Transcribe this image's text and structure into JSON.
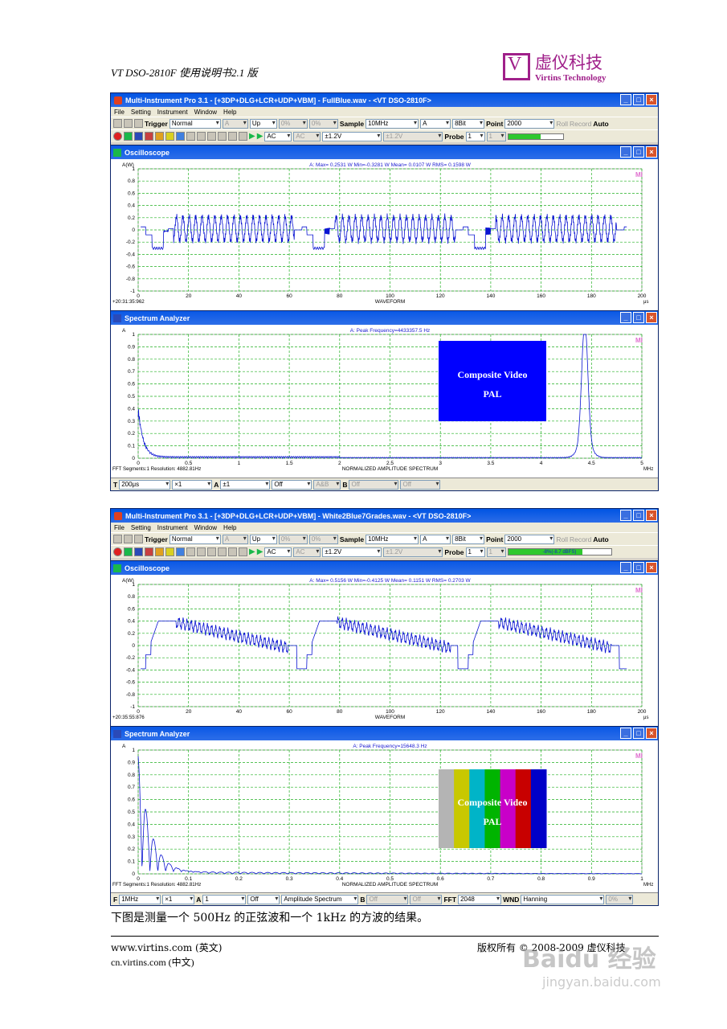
{
  "doc": {
    "header_title": "VT DSO-2810F 使用说明书2.1 版",
    "logo_cn": "虚仪科技",
    "logo_en": "Virtins Technology",
    "caption": "下图是测量一个 500Hz 的正弦波和一个 1kHz 的方波的结果。",
    "footer_left_1": "www.virtins.com (英文)",
    "footer_left_2": "cn.virtins.com (中文)",
    "footer_right": "版权所有 © 2008-2009 虚仪科技",
    "watermark": "Baidu 经验",
    "watermark_url": "jingyan.baidu.com"
  },
  "menu": [
    "File",
    "Setting",
    "Instrument",
    "Window",
    "Help"
  ],
  "toolbar": {
    "trigger_label": "Trigger",
    "trigger_mode": "Normal",
    "trigger_ch": "A",
    "trigger_edge": "Up",
    "pct1": "0%",
    "pct2": "0%",
    "sample_label": "Sample",
    "sample_rate": "10MHz",
    "channel": "A",
    "bits": "8Bit",
    "point_label": "Point",
    "points": "2000",
    "roll": "Roll",
    "record": "Record",
    "auto": "Auto",
    "coupling_a": "AC",
    "coupling_b": "AC",
    "range_a": "±1.2V",
    "range_b": "±1.2V",
    "probe_label": "Probe",
    "probe_a": "1",
    "probe_b": "1"
  },
  "windows": [
    {
      "title": "Multi-Instrument Pro 3.1   -  [+3DP+DLG+LCR+UDP+VBM]     -     FullBlue.wav     -    <VT DSO-2810F>",
      "level": "",
      "osc": {
        "title": "Oscilloscope",
        "ylabel": "A(W)",
        "stats": "A: Max= 0.2531 W  Min=-0.3281 W  Mean= 0.0107 W  RMS= 0.1598 W",
        "timestamp": "+20:31:35:962",
        "xlabel": "WAVEFORM",
        "xunit": "μs"
      },
      "spec": {
        "title": "Spectrum Analyzer",
        "ylabel": "A",
        "peak": "A: Peak Frequency=4433357.5 Hz",
        "footer_left": "FFT Segments:1    Resolution: 4882.81Hz",
        "xlabel": "NORMALIZED AMPLITUDE SPECTRUM",
        "xunit": "MHz",
        "inset_line1": "Composite Video",
        "inset_line2": "PAL"
      },
      "bottom": [
        "T",
        "200μs",
        "×1",
        "A",
        "±1",
        "Off",
        "A&B",
        "B",
        "Off",
        "Off"
      ]
    },
    {
      "title": "Multi-Instrument Pro 3.1   -  [+3DP+DLG+LCR+UDP+VBM]     -     White2Blue7Grades.wav     -    <VT DSO-2810F>",
      "level": "-8%(-8.7 dBFS)",
      "osc": {
        "title": "Oscilloscope",
        "ylabel": "A(W)",
        "stats": "A: Max= 0.5156 W  Min=-0.4125 W  Mean= 0.1151 W  RMS= 0.2703 W",
        "timestamp": "+20:35:55:876",
        "xlabel": "WAVEFORM",
        "xunit": "μs"
      },
      "spec": {
        "title": "Spectrum Analyzer",
        "ylabel": "A",
        "peak": "A: Peak Frequency=15648.3 Hz",
        "footer_left": "FFT Segments:1    Resolution: 4882.81Hz",
        "xlabel": "NORMALIZED AMPLITUDE SPECTRUM",
        "xunit": "MHz",
        "inset_line1": "Composite Video",
        "inset_line2": "PAL"
      },
      "bottom": [
        "F",
        "1MHz",
        "×1",
        "A",
        "1",
        "Off",
        "Amplitude Spectrum",
        "B",
        "Off",
        "Off",
        "FFT",
        "2048",
        "WND",
        "Hanning",
        "0%"
      ]
    }
  ],
  "chart_data": [
    {
      "type": "line",
      "title": "Oscilloscope",
      "xlabel": "WAVEFORM",
      "ylabel": "A(W)",
      "x_unit": "μs",
      "xlim": [
        0,
        200
      ],
      "ylim": [
        -1,
        1
      ],
      "xticks": [
        0,
        20,
        40,
        60,
        80,
        100,
        120,
        140,
        160,
        180,
        200
      ],
      "yticks": [
        1,
        0.8,
        0.6,
        0.4,
        0.2,
        0,
        -0.2,
        -0.4,
        -0.6,
        -0.8,
        -1
      ],
      "grid": true,
      "series": [
        {
          "signal": "composite video, full blue",
          "max": 0.2531,
          "min": -0.3281,
          "mean": 0.0107,
          "rms": 0.1598
        }
      ]
    },
    {
      "type": "line",
      "title": "Spectrum Analyzer",
      "xlabel": "NORMALIZED AMPLITUDE SPECTRUM",
      "ylabel": "A",
      "x_unit": "MHz",
      "xlim": [
        0,
        5
      ],
      "ylim": [
        0,
        1
      ],
      "xticks": [
        0,
        0.5,
        1,
        1.5,
        2,
        2.5,
        3,
        3.5,
        4,
        4.5,
        5
      ],
      "yticks": [
        1,
        0.9,
        0.8,
        0.7,
        0.6,
        0.5,
        0.4,
        0.3,
        0.2,
        0.1,
        0
      ],
      "grid": true,
      "peak_frequency_hz": 4433357.5
    },
    {
      "type": "line",
      "title": "Oscilloscope",
      "xlabel": "WAVEFORM",
      "ylabel": "A(W)",
      "x_unit": "μs",
      "xlim": [
        0,
        200
      ],
      "ylim": [
        -1,
        1
      ],
      "xticks": [
        0,
        20,
        40,
        60,
        80,
        100,
        120,
        140,
        160,
        180,
        200
      ],
      "yticks": [
        1,
        0.8,
        0.6,
        0.4,
        0.2,
        0,
        -0.2,
        -0.4,
        -0.6,
        -0.8,
        -1
      ],
      "grid": true,
      "series": [
        {
          "signal": "composite video, white to blue 7 grades",
          "max": 0.5156,
          "min": -0.4125,
          "mean": 0.1151,
          "rms": 0.2703
        }
      ]
    },
    {
      "type": "line",
      "title": "Spectrum Analyzer",
      "xlabel": "NORMALIZED AMPLITUDE SPECTRUM",
      "ylabel": "A",
      "x_unit": "MHz",
      "xlim": [
        0,
        1
      ],
      "ylim": [
        0,
        1
      ],
      "xticks": [
        0,
        0.1,
        0.2,
        0.3,
        0.4,
        0.5,
        0.6,
        0.7,
        0.8,
        0.9,
        1
      ],
      "yticks": [
        1,
        0.9,
        0.8,
        0.7,
        0.6,
        0.5,
        0.4,
        0.3,
        0.2,
        0.1,
        0
      ],
      "grid": true,
      "peak_frequency_hz": 15648.3
    }
  ],
  "colors": {
    "trace": "#0a14d2",
    "grid": "#22b022",
    "bar_colors": [
      "#b4b4b4",
      "#c8c800",
      "#00b4c8",
      "#00b400",
      "#c800c8",
      "#c80000",
      "#0000c8"
    ],
    "inset_blue": "#0000ff"
  }
}
